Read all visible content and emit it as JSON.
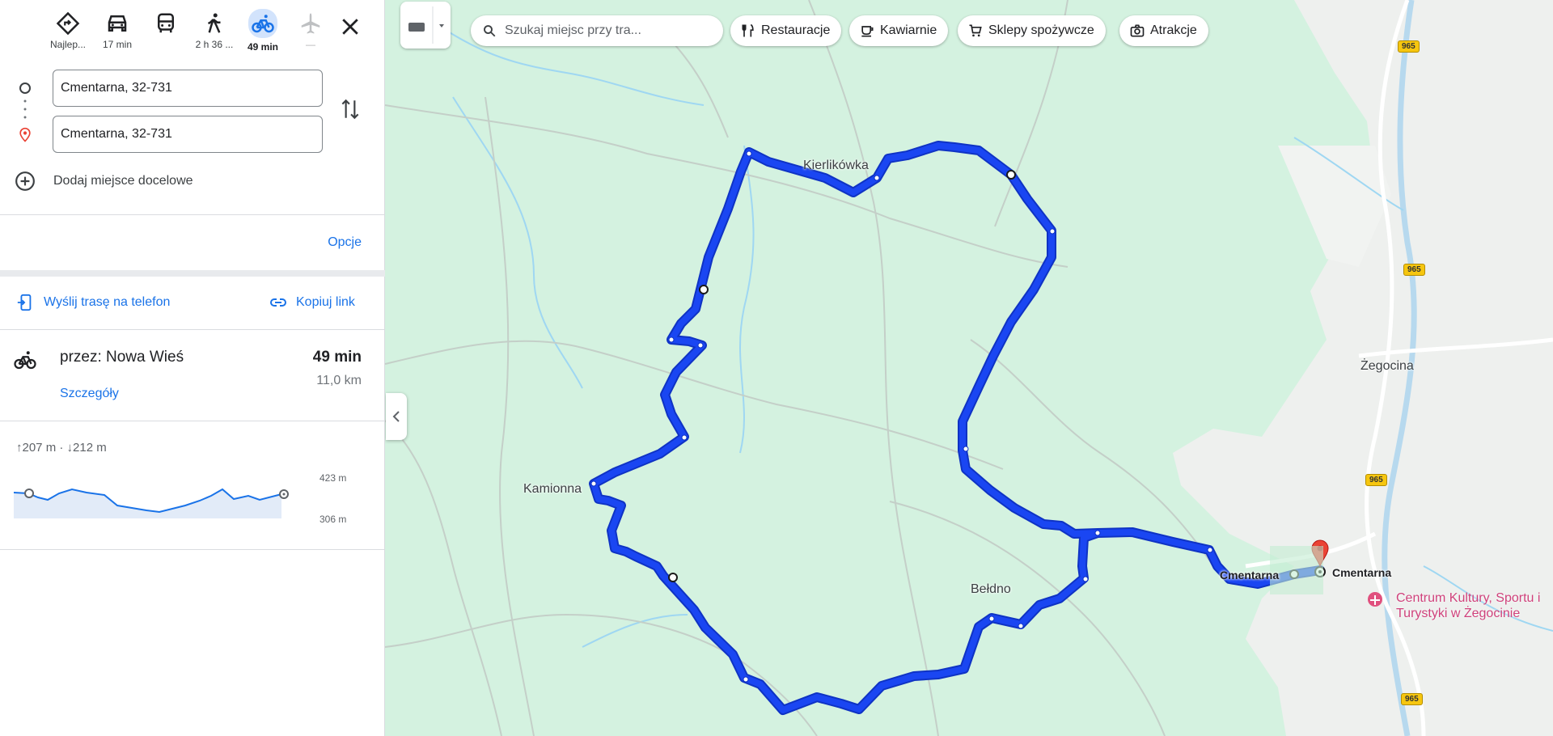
{
  "modes": [
    {
      "id": "best",
      "label": "Najlep...",
      "icon": "best-route-icon"
    },
    {
      "id": "car",
      "label": "17 min",
      "icon": "car-icon"
    },
    {
      "id": "transit",
      "label": "",
      "icon": "bus-icon"
    },
    {
      "id": "walk",
      "label": "2 h 36 ...",
      "icon": "walk-icon"
    },
    {
      "id": "bike",
      "label": "49 min",
      "icon": "bike-icon",
      "active": true
    },
    {
      "id": "flight",
      "label": "—",
      "icon": "plane-icon",
      "disabled": true
    }
  ],
  "directions": {
    "origin": "Cmentarna, 32-731",
    "destination": "Cmentarna, 32-731",
    "add_destination": "Dodaj miejsce docelowe",
    "options": "Opcje",
    "send_to_phone": "Wyślij trasę na telefon",
    "copy_link": "Kopiuj link"
  },
  "route": {
    "via": "przez: Nowa Wieś",
    "time": "49 min",
    "distance": "11,0 km",
    "details": "Szczegóły",
    "elevation_summary": "↑207 m · ↓212 m",
    "elevation_max": "423 m",
    "elevation_min": "306 m"
  },
  "map": {
    "search_placeholder": "Szukaj miejsc przy tra...",
    "chips": [
      {
        "label": "Restauracje",
        "icon": "fork-knife-icon"
      },
      {
        "label": "Kawiarnie",
        "icon": "coffee-icon"
      },
      {
        "label": "Sklepy spożywcze",
        "icon": "cart-icon"
      },
      {
        "label": "Atrakcje",
        "icon": "camera-icon"
      }
    ],
    "places": {
      "kierlikowka": "Kierlikówka",
      "kamionna": "Kamionna",
      "beldno": "Bełdno",
      "zegocina": "Żegocina",
      "cmentarna_a": "Cmentarna",
      "cmentarna_b": "Cmentarna",
      "poi": "Centrum Kultury, Sportu i Turystyki w Żegocinie"
    },
    "road_number": "965",
    "colors": {
      "route": "#1a46f2",
      "map": "#d4f2e0",
      "accent": "#1a73e8",
      "pin": "#ea4335"
    }
  }
}
